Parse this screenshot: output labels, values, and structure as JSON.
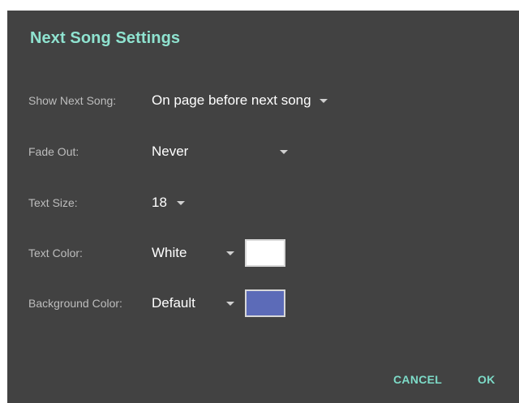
{
  "dialog": {
    "title": "Next Song Settings"
  },
  "settings": {
    "show_next_song": {
      "label": "Show Next Song:",
      "value": "On page before next song",
      "caret_icon": "dropdown-triangle-icon"
    },
    "fade_out": {
      "label": "Fade Out:",
      "value": "Never",
      "caret_icon": "dropdown-triangle-icon"
    },
    "text_size": {
      "label": "Text Size:",
      "value": "18",
      "caret_icon": "dropdown-triangle-icon"
    },
    "text_color": {
      "label": "Text Color:",
      "value": "White",
      "caret_icon": "dropdown-triangle-icon",
      "swatch_color": "#ffffff"
    },
    "background_color": {
      "label": "Background Color:",
      "value": "Default",
      "caret_icon": "dropdown-triangle-icon",
      "swatch_color": "#5c6bb8"
    }
  },
  "buttons": {
    "cancel_label": "CANCEL",
    "ok_label": "OK"
  },
  "colors": {
    "dialog_background": "#424242",
    "accent": "#7ddbc8",
    "title_color": "#8fe3d0",
    "label_color": "#bdbdbd",
    "value_color": "#ffffff"
  }
}
